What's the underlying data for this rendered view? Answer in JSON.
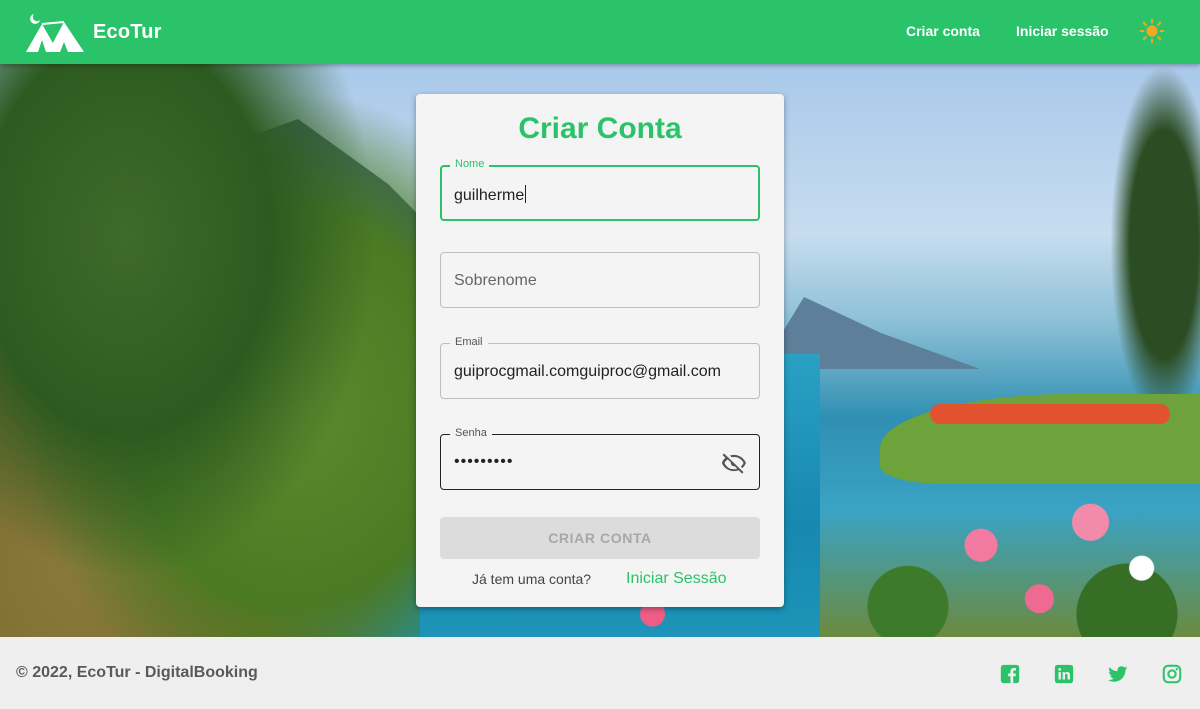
{
  "colors": {
    "brand": "#2bc36a",
    "footer_bg": "#efefef",
    "card_bg": "#f4f4f4",
    "button_disabled": "#dcdcdc"
  },
  "header": {
    "brand": "EcoTur",
    "nav": {
      "create_account": "Criar conta",
      "sign_in": "Iniciar sessão"
    },
    "theme_icon": "sun-icon"
  },
  "form": {
    "title": "Criar Conta",
    "fields": {
      "nome": {
        "label": "Nome",
        "value": "guilherme"
      },
      "sobrenome": {
        "placeholder": "Sobrenome"
      },
      "email": {
        "label": "Email",
        "value": "guiprocgmail.comguiproc@gmail.com"
      },
      "senha": {
        "label": "Senha",
        "value": "•••••••••"
      }
    },
    "submit_label": "CRIAR CONTA",
    "has_account_text": "Já tem uma conta?",
    "sign_in_link": "Iniciar Sessão"
  },
  "footer": {
    "copyright": "© 2022, EcoTur - DigitalBooking",
    "social_icons": [
      "facebook-icon",
      "linkedin-icon",
      "twitter-icon",
      "instagram-icon"
    ]
  }
}
